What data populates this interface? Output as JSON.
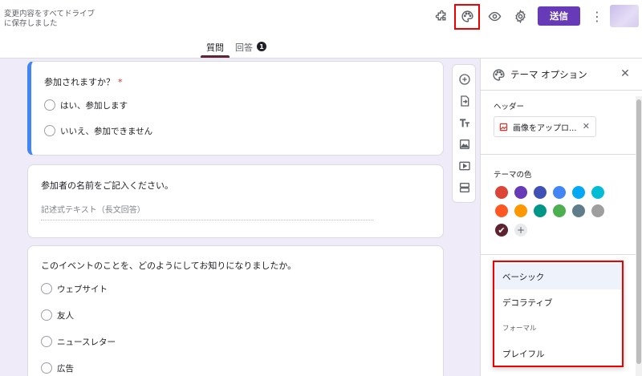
{
  "header": {
    "save_status": "変更内容をすべてドライブに保存しました",
    "send_label": "送信"
  },
  "icons": {
    "addon": "puzzle-icon",
    "palette": "palette-icon",
    "preview": "eye-icon",
    "settings": "gear-icon",
    "more": "more-vert-icon"
  },
  "tabs": {
    "questions": "質問",
    "responses": "回答",
    "response_count": "1"
  },
  "cards": {
    "q1": {
      "title": "参加されますか？",
      "required_mark": "*",
      "options": [
        "はい、参加します",
        "いいえ、参加できません"
      ]
    },
    "q2": {
      "title": "参加者の名前をご記入ください。",
      "placeholder": "記述式テキスト（長文回答）"
    },
    "q3": {
      "title": "このイベントのことを、どのようにしてお知りになりましたか。",
      "options": [
        "ウェブサイト",
        "友人",
        "ニュースレター",
        "広告"
      ]
    }
  },
  "theme_panel": {
    "title": "テーマ オプション",
    "header_label": "ヘッダー",
    "upload_label": "画像をアップロ...",
    "color_label": "テーマの色",
    "colors": [
      "#db4437",
      "#673ab7",
      "#3f51b5",
      "#4285f4",
      "#03a9f4",
      "#00bcd4",
      "#ff5722",
      "#ff9800",
      "#009688",
      "#4caf50",
      "#607d8b",
      "#9e9e9e"
    ],
    "selected_color": "#5e2230"
  },
  "font_dropdown": {
    "items": [
      {
        "label": "ベーシック",
        "selected": true
      },
      {
        "label": "デコラティブ",
        "selected": false
      },
      {
        "label": "フォーマル",
        "selected": false
      },
      {
        "label": "プレイフル",
        "selected": false
      }
    ]
  },
  "accent": {
    "purple": "#673ab7",
    "blue": "#4285f4",
    "highlight": "#ee0000"
  }
}
